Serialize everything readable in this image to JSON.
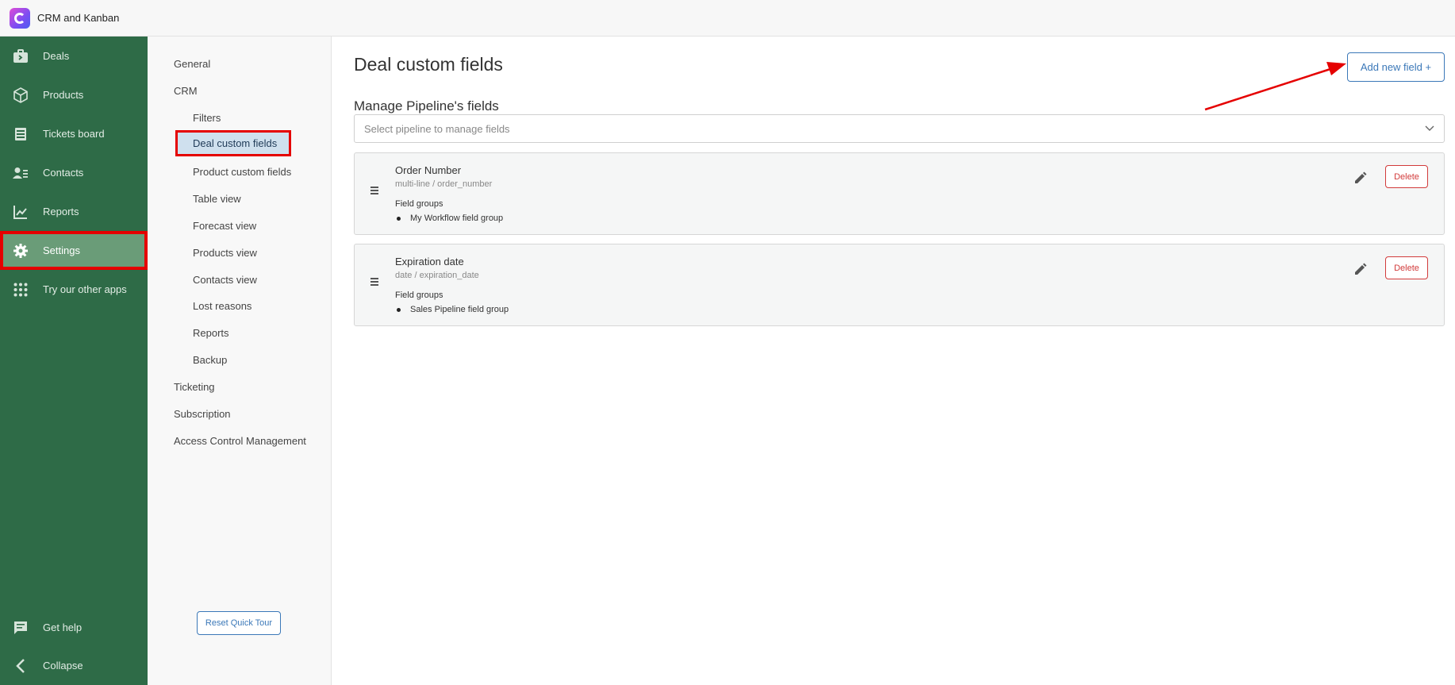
{
  "app": {
    "title": "CRM and Kanban",
    "brand_color": "#2e6b47",
    "accent": "#3b78b8",
    "danger": "#d23b3b"
  },
  "leftnav": {
    "items": [
      {
        "label": "Deals",
        "icon": "briefcase-icon"
      },
      {
        "label": "Products",
        "icon": "box-icon"
      },
      {
        "label": "Tickets board",
        "icon": "tickets-icon"
      },
      {
        "label": "Contacts",
        "icon": "contacts-icon"
      },
      {
        "label": "Reports",
        "icon": "chart-icon"
      },
      {
        "label": "Settings",
        "icon": "gear-icon",
        "active": true
      },
      {
        "label": "Try our other apps",
        "icon": "apps-grid-icon"
      }
    ],
    "bottom": [
      {
        "label": "Get help",
        "icon": "chat-icon"
      },
      {
        "label": "Collapse",
        "icon": "chevron-left-icon"
      }
    ]
  },
  "subnav": {
    "items": [
      "General",
      "CRM",
      "Filters",
      "Deal custom fields",
      "Product custom fields",
      "Table view",
      "Forecast view",
      "Products view",
      "Contacts view",
      "Lost reasons",
      "Reports",
      "Backup",
      "Ticketing",
      "Subscription",
      "Access Control Management"
    ],
    "reset_label": "Reset Quick Tour"
  },
  "main": {
    "title": "Deal custom fields",
    "add_button": "Add new field +",
    "section_title": "Manage Pipeline's fields",
    "select_placeholder": "Select pipeline to manage fields",
    "fields": [
      {
        "name": "Order Number",
        "type": "multi-line / order_number",
        "groups_label": "Field groups",
        "groups": [
          "My Workflow field group"
        ],
        "delete_label": "Delete"
      },
      {
        "name": "Expiration date",
        "type": "date / expiration_date",
        "groups_label": "Field groups",
        "groups": [
          "Sales Pipeline field group"
        ],
        "delete_label": "Delete"
      }
    ]
  }
}
